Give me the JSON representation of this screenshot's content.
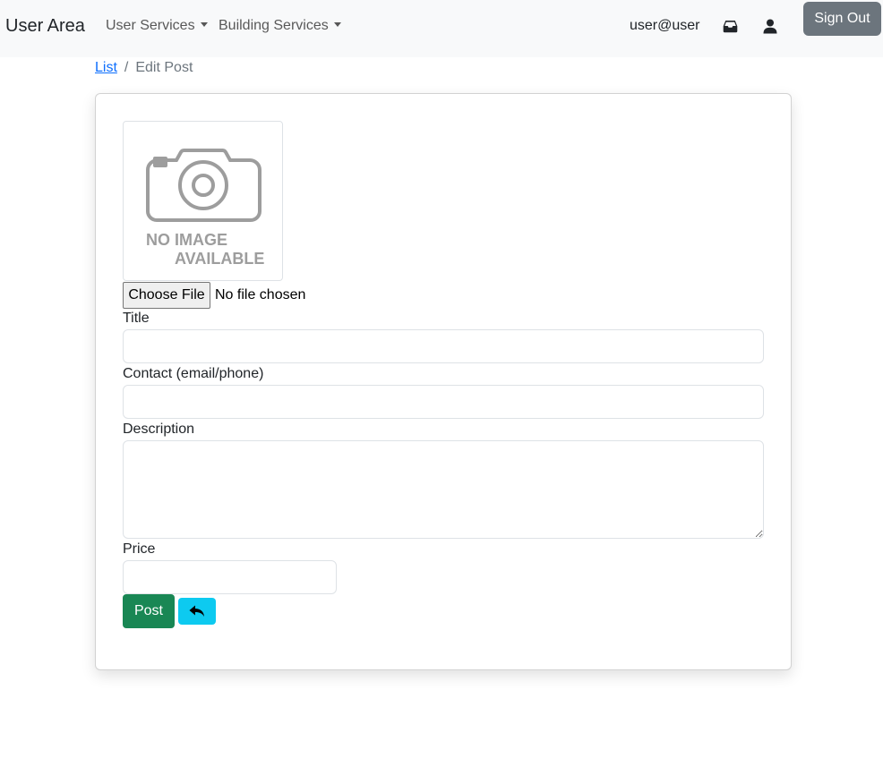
{
  "navbar": {
    "brand": "User Area",
    "menus": [
      {
        "label": "User Services"
      },
      {
        "label": "Building Services"
      }
    ],
    "user_email": "user@user",
    "inbox_icon": "inbox-icon",
    "profile_icon": "user-icon",
    "signout_label": "Sign Out"
  },
  "breadcrumb": {
    "link": "List",
    "separator": "/",
    "current": "Edit Post"
  },
  "form": {
    "image": {
      "line1": "NO IMAGE",
      "line2": "AVAILABLE",
      "icon": "camera-icon"
    },
    "file": {
      "button_label": "Choose File",
      "status": "No file chosen"
    },
    "title": {
      "label": "Title",
      "value": ""
    },
    "contact": {
      "label": "Contact (email/phone)",
      "value": ""
    },
    "description": {
      "label": "Description",
      "value": ""
    },
    "price": {
      "label": "Price",
      "value": ""
    },
    "post_label": "Post",
    "back_icon": "reply-icon"
  },
  "colors": {
    "navbar_bg": "#f8f9fa",
    "signout_bg": "#6c757d",
    "post_bg": "#198754",
    "back_bg": "#0dcaf0",
    "link": "#0d6efd"
  }
}
